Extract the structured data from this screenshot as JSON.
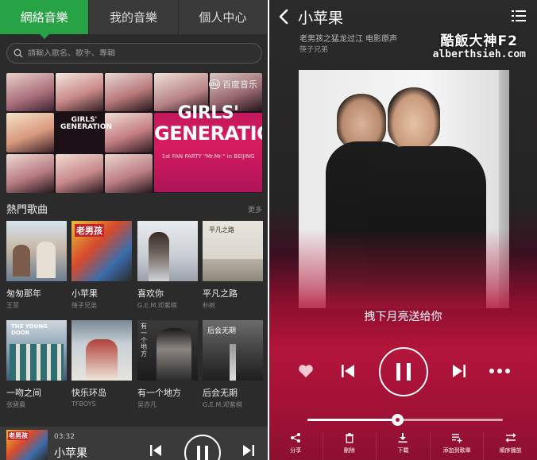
{
  "left": {
    "tabs": [
      {
        "label": "網絡音樂",
        "active": true
      },
      {
        "label": "我的音樂",
        "active": false
      },
      {
        "label": "個人中心",
        "active": false
      }
    ],
    "search": {
      "placeholder": "請輸入歌名、歌手、專輯"
    },
    "banner": {
      "brand": "百度音乐",
      "brand_logo": "du",
      "headline_line1": "GIRLS'",
      "headline_line2": "GENERATION",
      "headline_sub": "1st FAN PARTY \"Mr.Mr.\" in BEIJING",
      "poster_line1": "GIRLS'",
      "poster_line2": "GENERATION"
    },
    "section": {
      "title": "熱門歌曲",
      "more": "更多"
    },
    "songs": [
      {
        "title": "匆匆那年",
        "artist": "王菲",
        "cover_text": ""
      },
      {
        "title": "小苹果",
        "artist": "筷子兄弟",
        "cover_text": "老男孩"
      },
      {
        "title": "喜欢你",
        "artist": "G.E.M.邓紫棋",
        "cover_text": ""
      },
      {
        "title": "平凡之路",
        "artist": "朴树",
        "cover_text": "平凡之路"
      },
      {
        "title": "一吻之间",
        "artist": "张碧晨",
        "cover_text": "THE YOUNG DOOR"
      },
      {
        "title": "快乐环岛",
        "artist": "TFBOYS",
        "cover_text": ""
      },
      {
        "title": "有一个地方",
        "artist": "吴亦凡",
        "cover_text": "有一个地方"
      },
      {
        "title": "后会无期",
        "artist": "G.E.M.邓紫棋",
        "cover_text": "后会无期"
      }
    ],
    "mini_player": {
      "time": "03:32",
      "title": "小苹果",
      "cover_text": "老男孩"
    }
  },
  "right": {
    "title": "小苹果",
    "album": "老男孩之猛龙过江 电影原声",
    "artist": "筷子兄弟",
    "watermark_line1": "酷飯大神F2",
    "watermark_line2": "alberthsieh.com",
    "lyric": "拽下月亮送给你",
    "progress": 0.46,
    "actions": [
      {
        "label": "分享",
        "icon": "share-icon"
      },
      {
        "label": "刪除",
        "icon": "trash-icon"
      },
      {
        "label": "下載",
        "icon": "download-icon"
      },
      {
        "label": "添加到歌單",
        "icon": "add-to-playlist-icon"
      },
      {
        "label": "順序播放",
        "icon": "sequential-play-icon"
      }
    ]
  },
  "colors": {
    "accent_green": "#27a245",
    "player_red": "#b3143a",
    "dark_bg": "#2b2b2b"
  }
}
